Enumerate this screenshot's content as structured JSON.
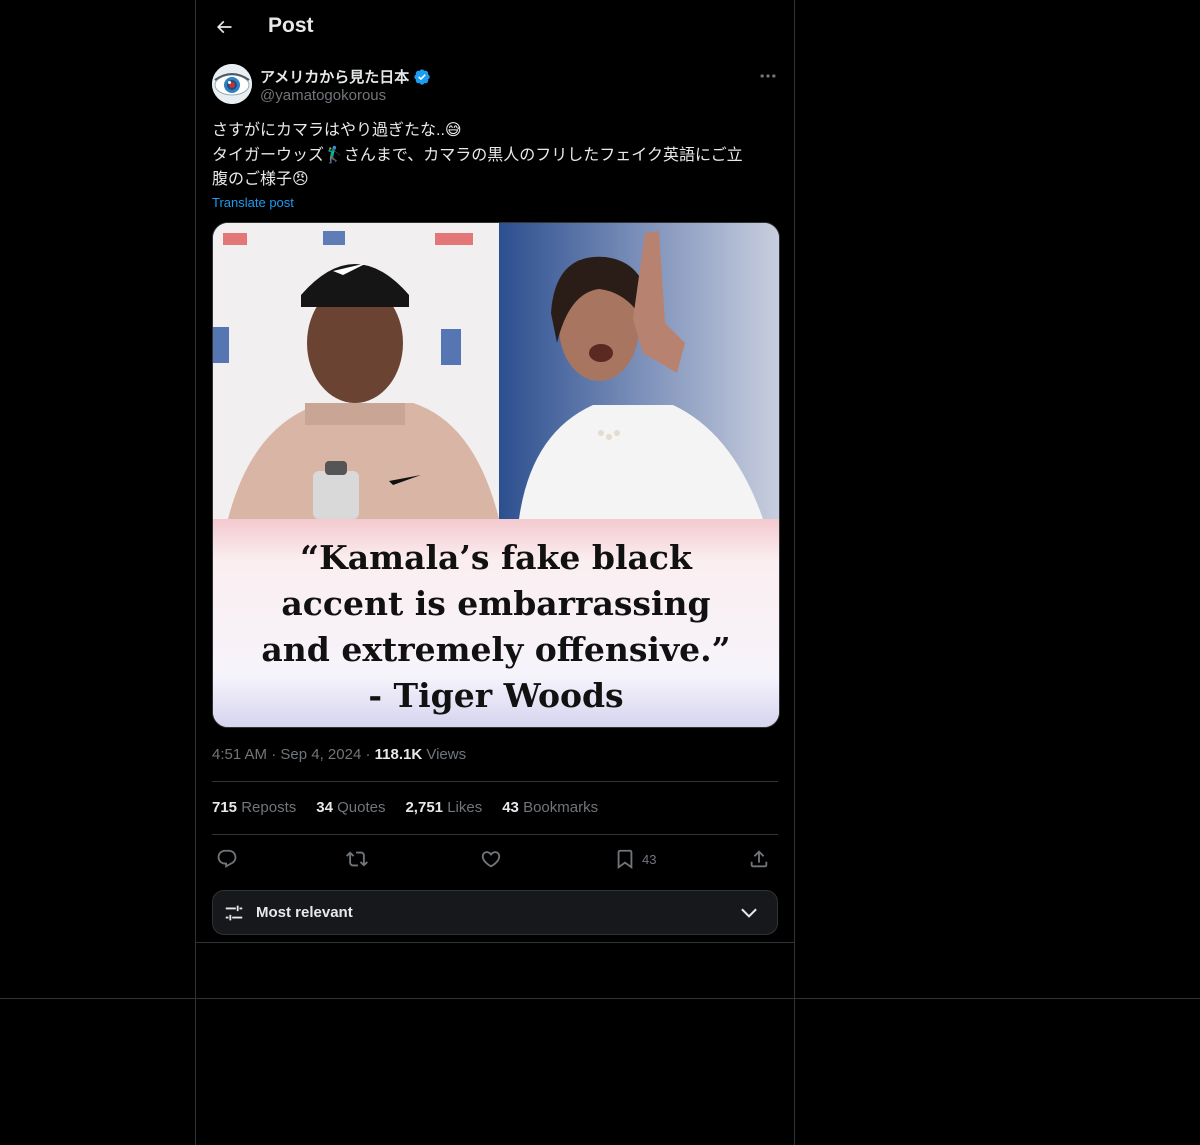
{
  "header": {
    "title": "Post",
    "back_icon": "arrow-left-icon"
  },
  "author": {
    "display_name": "アメリカから見た日本",
    "handle": "@yamatogokorous",
    "verified": true,
    "verified_color": "#1d9bf0"
  },
  "post": {
    "text_lines": [
      "さすがにカマラはやり過ぎたな..😅",
      "タイガーウッズ🏌️‍♂️さんまで、カマラの黒人のフリしたフェイク英語にご立",
      "腹のご様子😠"
    ],
    "translate_label": "Translate post",
    "image": {
      "caption_lines": [
        "“Kamala’s fake black",
        "accent is embarrassing",
        "and extremely offensive.”",
        "- Tiger Woods"
      ]
    },
    "time": "4:51 AM",
    "dot1": "·",
    "date": "Sep 4, 2024",
    "dot2": "·",
    "views_count": "118.1K",
    "views_label": "Views"
  },
  "stats": {
    "reposts_count": "715",
    "reposts_label": "Reposts",
    "quotes_count": "34",
    "quotes_label": "Quotes",
    "likes_count": "2,751",
    "likes_label": "Likes",
    "bookmarks_count": "43",
    "bookmarks_label": "Bookmarks"
  },
  "actions": {
    "bookmark_count": "43",
    "icons": [
      "reply-icon",
      "repost-icon",
      "like-icon",
      "bookmark-icon",
      "share-icon"
    ]
  },
  "sort": {
    "label": "Most relevant",
    "icon": "sliders-icon",
    "chevron": "chevron-down-icon"
  },
  "colors": {
    "background": "#000000",
    "text": "#e7e9ea",
    "muted": "#71767b",
    "accent": "#1d9bf0",
    "border": "#2f3336"
  }
}
